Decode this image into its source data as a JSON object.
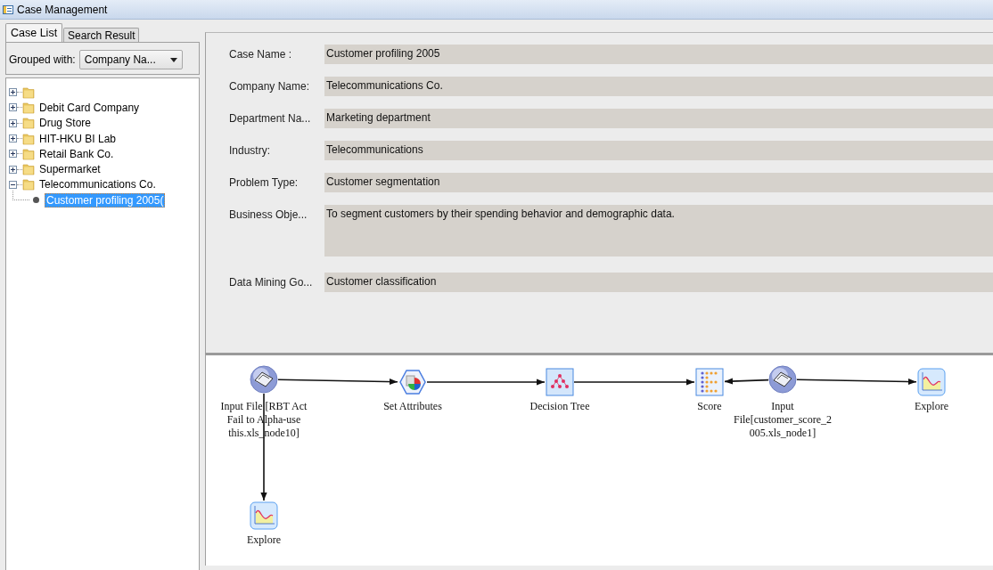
{
  "window": {
    "title": "Case Management"
  },
  "tabs": [
    {
      "label": "Case List",
      "selected": true
    },
    {
      "label": "Search Result",
      "selected": false
    }
  ],
  "grouping": {
    "label": "Grouped with:",
    "value": "Company Na..."
  },
  "tree": [
    {
      "expanded": false,
      "selected": false
    },
    {
      "label": "Debit Card Company",
      "expanded": false,
      "selected": false
    },
    {
      "label": "Drug Store",
      "expanded": false,
      "selected": false
    },
    {
      "label": "HIT-HKU BI Lab",
      "expanded": false,
      "selected": false
    },
    {
      "label": "Retail Bank Co.",
      "expanded": false,
      "selected": false
    },
    {
      "label": "Supermarket",
      "expanded": false,
      "selected": false
    },
    {
      "label": "Telecommunications Co.",
      "expanded": true,
      "selected": false,
      "children": [
        {
          "label": "Customer profiling 2005(",
          "selected": true
        }
      ]
    }
  ],
  "fields": [
    {
      "label": "Case Name :",
      "value": "Customer profiling 2005",
      "kind": "line"
    },
    {
      "label": "Company Name:",
      "value": "Telecommunications Co.",
      "kind": "line"
    },
    {
      "label": "Department Na...",
      "value": "Marketing department",
      "kind": "line"
    },
    {
      "label": "Industry:",
      "value": "Telecommunications",
      "kind": "line"
    },
    {
      "label": "Problem Type:",
      "value": "Customer segmentation",
      "kind": "line"
    },
    {
      "label": "Business Obje...",
      "value": "To segment customers by their spending behavior and demographic data.",
      "kind": "area"
    },
    {
      "label": "Data Mining Go...",
      "value": "Customer classification",
      "kind": "line"
    }
  ],
  "flow": {
    "nodes": [
      {
        "kind": "input",
        "label": [
          "Input File [RBT Act",
          "Fail to Alpha-use",
          "this.xls_node10]"
        ]
      },
      {
        "kind": "attributes",
        "label": [
          "Set Attributes"
        ]
      },
      {
        "kind": "tree",
        "label": [
          "Decision Tree"
        ]
      },
      {
        "kind": "score",
        "label": [
          "Score"
        ]
      },
      {
        "kind": "input",
        "label": [
          "Input",
          "File[customer_score_2",
          "005.xls_node1]"
        ]
      },
      {
        "kind": "explore",
        "label": [
          "Explore"
        ]
      },
      {
        "kind": "explore",
        "label": [
          "Explore"
        ]
      }
    ]
  }
}
